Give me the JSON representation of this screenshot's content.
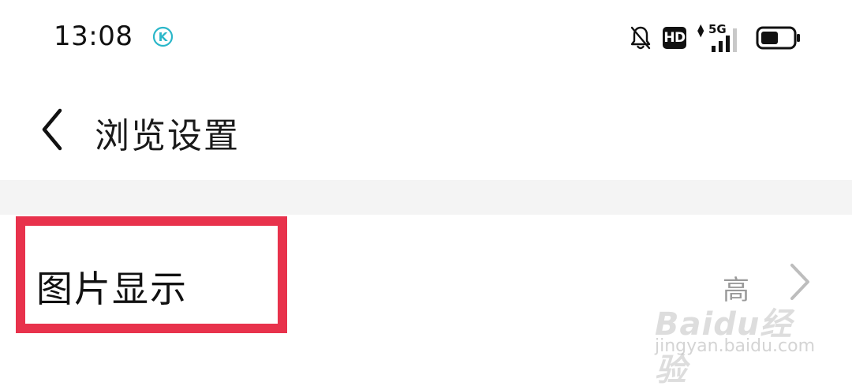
{
  "status_bar": {
    "time": "13:08",
    "app_badge_letter": "K",
    "network_label": "5G",
    "hd_label": "HD",
    "battery_level": 0.55
  },
  "header": {
    "title": "浏览设置"
  },
  "settings": {
    "rows": [
      {
        "label": "图片显示",
        "value": "高"
      }
    ]
  },
  "watermark": {
    "logo": "Baidu经验",
    "url": "jingyan.baidu.com"
  },
  "colors": {
    "highlight": "#e8324c",
    "divider": "#f4f4f4",
    "value_text": "#9a9a9a",
    "badge_teal": "#2bb7c9"
  }
}
